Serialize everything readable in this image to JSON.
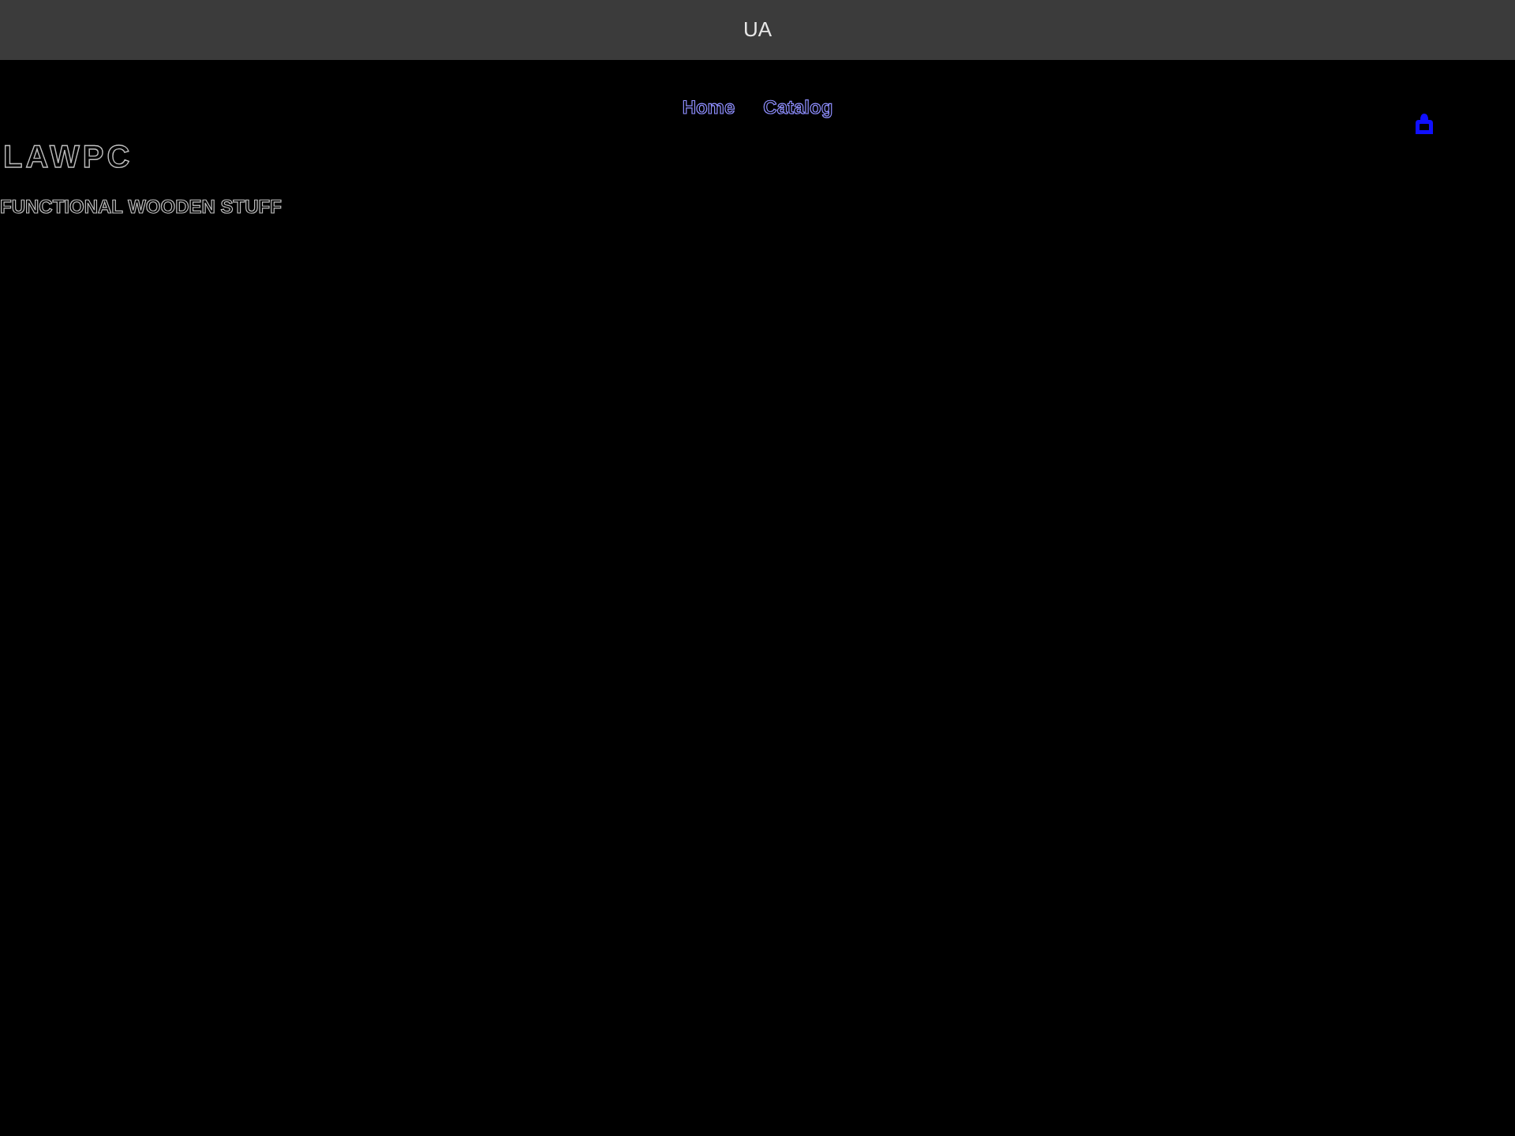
{
  "top_bar": {
    "label": "UA"
  },
  "nav": {
    "links": [
      "Home",
      "Catalog"
    ]
  },
  "brand": {
    "logo": "LAWPC",
    "tagline": "FUNCTIONAL WOODEN STUFF"
  }
}
